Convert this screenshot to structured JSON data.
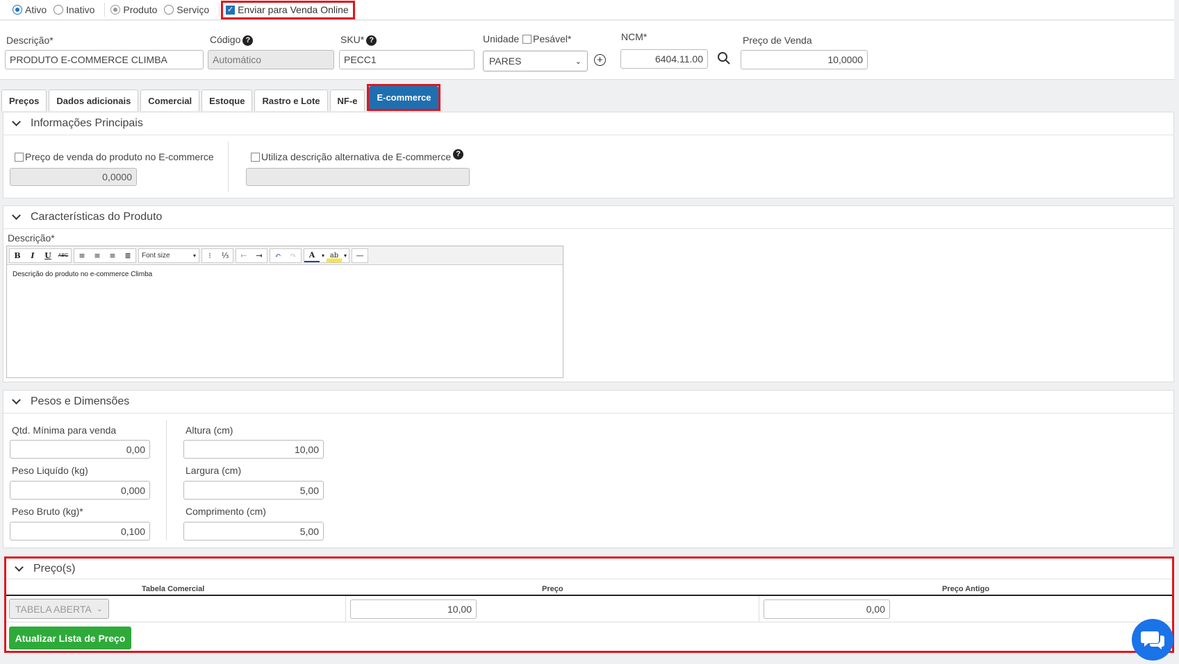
{
  "status": {
    "ativo": "Ativo",
    "inativo": "Inativo",
    "produto": "Produto",
    "servico": "Serviço",
    "enviar_online": "Enviar para Venda Online"
  },
  "header": {
    "descricao_label": "Descrição*",
    "descricao_value": "PRODUTO E-COMMERCE CLIMBA",
    "codigo_label": "Código",
    "codigo_value": "Automático",
    "sku_label": "SKU*",
    "sku_value": "PECC1",
    "unidade_label": "Unidade",
    "pesavel_label": "Pesável*",
    "unidade_value": "PARES",
    "ncm_label": "NCM*",
    "ncm_value": "6404.11.00",
    "preco_label": "Preço de Venda",
    "preco_value": "10,0000",
    "help_glyph": "?"
  },
  "tabs": [
    "Preços",
    "Dados adicionais",
    "Comercial",
    "Estoque",
    "Rastro e Lote",
    "NF-e",
    "E-commerce"
  ],
  "info": {
    "title": "Informações Principais",
    "preco_ecom_label": "Preço de venda do produto no E-commerce",
    "preco_ecom_value": "0,0000",
    "desc_alt_label": "Utiliza descrição alternativa de E-commerce"
  },
  "caracteristicas": {
    "title": "Características do Produto",
    "descricao_label": "Descrição*",
    "font_size": "Font size",
    "editor_text": "Descrição do produto no e-commerce Climba"
  },
  "pesos": {
    "title": "Pesos e Dimensões",
    "qtd_label": "Qtd. Mínima para venda",
    "qtd_value": "0,00",
    "liquido_label": "Peso Liquído (kg)",
    "liquido_value": "0,000",
    "bruto_label": "Peso Bruto (kg)*",
    "bruto_value": "0,100",
    "altura_label": "Altura (cm)",
    "altura_value": "10,00",
    "largura_label": "Largura (cm)",
    "largura_value": "5,00",
    "comprimento_label": "Comprimento (cm)",
    "comprimento_value": "5,00"
  },
  "precos": {
    "title": "Preço(s)",
    "col_tabela": "Tabela Comercial",
    "col_preco": "Preço",
    "col_antigo": "Preço Antigo",
    "tabela_value": "TABELA ABERTA",
    "preco_value": "10,00",
    "antigo_value": "0,00",
    "atualizar": "Atualizar Lista de Preço"
  },
  "colors": {
    "accent": "#1f6fb0",
    "highlight": "#e0161e",
    "green": "#2eaa3a",
    "chat": "#1a73e8"
  }
}
